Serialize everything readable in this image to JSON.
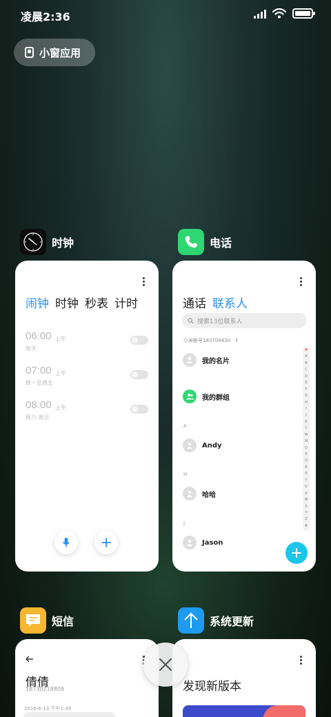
{
  "status_bar": {
    "time": "凌晨2:36",
    "battery_level": 1.0,
    "signal_level": 4
  },
  "mini_window_button": {
    "label": "小窗应用"
  },
  "colors": {
    "accent": "#2c8ff0",
    "phone_green": "#2fd772",
    "sms_yellow": "#f7b731",
    "update_blue": "#1e9bf0",
    "contacts_fab": "#1cc6e8"
  },
  "apps": {
    "clock": {
      "name": "时钟",
      "icon": "clock-icon",
      "tabs": [
        "闹钟",
        "时钟",
        "秒表",
        "计时"
      ],
      "active_tab": 0,
      "alarms": [
        {
          "time": "06:00",
          "ampm": "上午",
          "repeat": "每天",
          "enabled": false
        },
        {
          "time": "07:00",
          "ampm": "上午",
          "repeat": "周一至周五",
          "enabled": false
        },
        {
          "time": "08:00",
          "ampm": "上午",
          "repeat": "周六 周日",
          "enabled": false
        }
      ]
    },
    "phone": {
      "name": "电话",
      "icon": "phone-icon",
      "tabs": [
        "通话",
        "联系人"
      ],
      "active_tab": 1,
      "search_placeholder": "搜索13位联系人",
      "account": "小米帐号183704430",
      "my_card": "我的名片",
      "my_groups": "我的群组",
      "sections": [
        {
          "letter": "A",
          "contact": "Andy"
        },
        {
          "letter": "H",
          "contact": "哈哈"
        },
        {
          "letter": "J",
          "contact": "Jason"
        }
      ],
      "index": [
        "♥",
        "A",
        "B",
        "C",
        "D",
        "E",
        "F",
        "G",
        "H",
        "I",
        "J",
        "K",
        "L",
        "M",
        "N",
        "O",
        "P",
        "Q",
        "R",
        "S",
        "T",
        "U",
        "V",
        "W",
        "X",
        "Y",
        "Z",
        "#"
      ]
    },
    "sms": {
      "name": "短信",
      "icon": "message-icon",
      "contact_name": "倩倩",
      "contact_number": "18730218809",
      "date": "2016-6-13 下午1:49"
    },
    "update": {
      "name": "系统更新",
      "icon": "update-arrow-icon",
      "title": "发现新版本"
    }
  }
}
